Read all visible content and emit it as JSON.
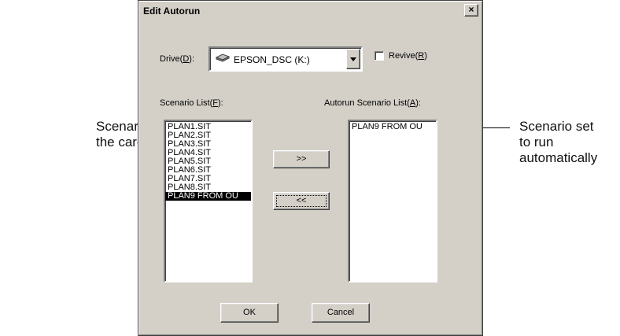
{
  "callouts": {
    "left": [
      "Scenarios on",
      "the card"
    ],
    "right": [
      "Scenario set",
      "to run",
      "automatically"
    ]
  },
  "dialog": {
    "title": "Edit Autorun",
    "close_label": "×",
    "drive": {
      "label_pre": "Drive(",
      "label_key": "D",
      "label_post": "):",
      "icon": "drive-icon",
      "value": "EPSON_DSC (K:)"
    },
    "revive": {
      "label_pre": "Revive(",
      "label_key": "R",
      "label_post": ")"
    },
    "scenario_list": {
      "label_pre": "Scenario List(",
      "label_key": "F",
      "label_post": "):",
      "items": [
        "PLAN1.SIT",
        "PLAN2.SIT",
        "PLAN3.SIT",
        "PLAN4.SIT",
        "PLAN5.SIT",
        "PLAN6.SIT",
        "PLAN7.SIT",
        "PLAN8.SIT",
        "PLAN9 FROM OU"
      ],
      "selected_index": 8
    },
    "autorun_list": {
      "label_pre": "Autorun Scenario List(",
      "label_key": "A",
      "label_post": "):",
      "items": [
        "PLAN9 FROM OU"
      ]
    },
    "add_label": ">>",
    "remove_label": "<<",
    "ok_label": "OK",
    "cancel_label": "Cancel"
  },
  "colors": {
    "dialog_bg": "#d4d0c8",
    "selection": "#000000"
  }
}
